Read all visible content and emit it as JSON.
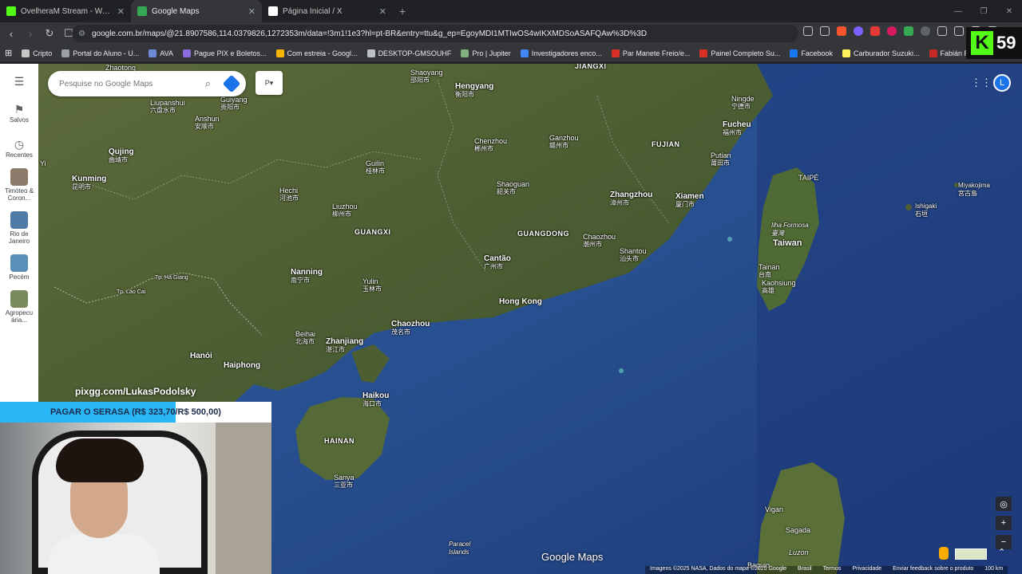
{
  "browser": {
    "tabs": [
      {
        "title": "OvelheraM Stream - Watch Live on K",
        "favicon": "kick-icon",
        "color": "#53fc18",
        "active": false
      },
      {
        "title": "Google Maps",
        "favicon": "maps-icon",
        "color": "#34a853",
        "active": true
      },
      {
        "title": "Página Inicial / X",
        "favicon": "x-icon",
        "color": "#ffffff",
        "active": false
      }
    ],
    "new_tab": "+",
    "url": "google.com.br/maps/@21.8907586,114.0379826,1272353m/data=!3m1!1e3?hl=pt-BR&entry=ttu&g_ep=EgoyMDI1MTIwOS4wIKXMDSoASAFQAw%3D%3D",
    "bookmarks": [
      {
        "label": "Cripto",
        "icon": "folder-icon",
        "color": "#c4c7c5"
      },
      {
        "label": "Portal do Aluno - U...",
        "icon": "globe-icon",
        "color": "#9aa0a6"
      },
      {
        "label": "AVA",
        "icon": "ava-icon",
        "color": "#6d8bd5"
      },
      {
        "label": "Pague PIX e Boletos...",
        "icon": "pix-icon",
        "color": "#8a6ce0"
      },
      {
        "label": "Com estreia - Googl...",
        "icon": "drive-icon",
        "color": "#f4b400"
      },
      {
        "label": "DESKTOP-GMSOUHF",
        "icon": "desktop-icon",
        "color": "#bdc1c6"
      },
      {
        "label": "Pro | Jupiter",
        "icon": "jupiter-icon",
        "color": "#7fb27f"
      },
      {
        "label": "Investigadores enco...",
        "icon": "google-icon",
        "color": "#4285f4"
      },
      {
        "label": "Par Manete Freio/e...",
        "icon": "shop-icon",
        "color": "#d93025"
      },
      {
        "label": "Painel Completo Su...",
        "icon": "shop-icon",
        "color": "#d93025"
      },
      {
        "label": "Facebook",
        "icon": "facebook-icon",
        "color": "#1877f2"
      },
      {
        "label": "Carburador Suzuki...",
        "icon": "ml-icon",
        "color": "#fff159"
      },
      {
        "label": "Fabián Ruiz FC Pro L...",
        "icon": "fc-icon",
        "color": "#c62828"
      }
    ],
    "kick_viewers": "59"
  },
  "maps": {
    "search_placeholder": "Pesquise no Google Maps",
    "rail": {
      "menu": "☰",
      "saved": "Salvos",
      "recent": "Recentes",
      "recent_places": [
        {
          "label": "Timóteo & Coron...",
          "color": "#8c7b6a"
        },
        {
          "label": "Rio de Janeiro",
          "color": "#4e7aa8"
        },
        {
          "label": "Pecém",
          "color": "#5a8fb8"
        },
        {
          "label": "Agropecu ária...",
          "color": "#7b8a5c"
        }
      ]
    },
    "avatar_letter": "L",
    "labels": {
      "hengyang": "Hengyang",
      "hengyang_zh": "衡阳市",
      "shaoyang": "Shaoyang",
      "shaoyang_zh": "邵阳市",
      "jiangxi": "JIANGXI",
      "fucheu": "Fucheu",
      "fucheu_zh": "福州市",
      "ningde": "Ningde",
      "ningde_zh": "宁德市",
      "fujian": "FUJIAN",
      "putian": "Putian",
      "putian_zh": "莆田市",
      "kunming": "Kunming",
      "kunming_zh": "昆明市",
      "qujing": "Qujing",
      "qujing_zh": "曲靖市",
      "anshun": "Anshun",
      "anshun_zh": "安顺市",
      "liupanshui": "Liupanshui",
      "liupanshui_zh": "六盘水市",
      "guiyang": "Guiyang",
      "guiyang_zh": "贵阳市",
      "zhaotong": "Zhaotong",
      "guangxi": "GUANGXI",
      "guangdong": "GUANGDONG",
      "hechi": "Hechi",
      "hechi_zh": "河池市",
      "guilin": "Guilin",
      "guilin_zh": "桂林市",
      "liuzhou": "Liuzhou",
      "liuzhou_zh": "柳州市",
      "chenzhou": "Chenzhou",
      "chenzhou_zh": "郴州市",
      "ganzhou": "Ganzhou",
      "ganzhou_zh": "赣州市",
      "shaoguan": "Shaoguan",
      "shaoguan_zh": "韶关市",
      "zhangzhou": "Zhangzhou",
      "zhangzhou_zh": "漳州市",
      "xiamen": "Xiamen",
      "xiamen_zh": "厦门市",
      "chaozhou": "Chaozhou",
      "chaozhou_zh": "潮州市",
      "shantou": "Shantou",
      "shantou_zh": "汕头市",
      "cantao": "Cantão",
      "cantao_zh": "广州市",
      "hongkong": "Hong Kong",
      "nanning": "Nanning",
      "nanning_zh": "南宁市",
      "yulin": "Yulin",
      "yulin_zh": "玉林市",
      "tphagiang": "Tp. Hà Giang",
      "tplaocai": "Tp. Lào Cai",
      "hanoi": "Hanói",
      "haiphong": "Haiphong",
      "beihai": "Beihai",
      "beihai_zh": "北海市",
      "zhanjiang": "Zhanjiang",
      "zhanjiang_zh": "湛江市",
      "maoming": "Chaozhou",
      "maoming_zh": "茂名市",
      "haikou": "Haikou",
      "haikou_zh": "海口市",
      "hainan": "HAINAN",
      "sanya": "Sanya",
      "sanya_zh": "三亚市",
      "taipe": "TAIPÉ",
      "taiwan": "Taiwan",
      "ilhaformosa": "Ilha Formosa",
      "ilhaformosa_zh": "臺灣",
      "tainan": "Tainan",
      "tainan_zh": "台南",
      "kaohsiung": "Kaohsiung",
      "kaohsiung_zh": "高雄",
      "miyakojima": "Miyakojima",
      "miyakojima_zh": "宮古島",
      "ishigaki": "Ishigaki",
      "ishigaki_zh": "石垣",
      "paracel": "Paracel Islands",
      "vigan": "Vigan",
      "sagada": "Sagada",
      "luzon": "Luzon",
      "baguio": "Baguio",
      "yi": "Yi"
    },
    "watermark": "Google Maps",
    "footer": [
      "Imagens ©2025 NASA, Dados do mapa ©2025 Google",
      "Brasil",
      "Termos",
      "Privacidade",
      "Enviar feedback sobre o produto",
      "100 km"
    ],
    "zoom_in": "+",
    "zoom_out": "−"
  },
  "stream": {
    "pix_link": "pixgg.com/LukasPodolsky",
    "goal_text": "PAGAR O SERASA (R$ 323,70/R$ 500,00)",
    "goal_progress": 0.6474
  }
}
